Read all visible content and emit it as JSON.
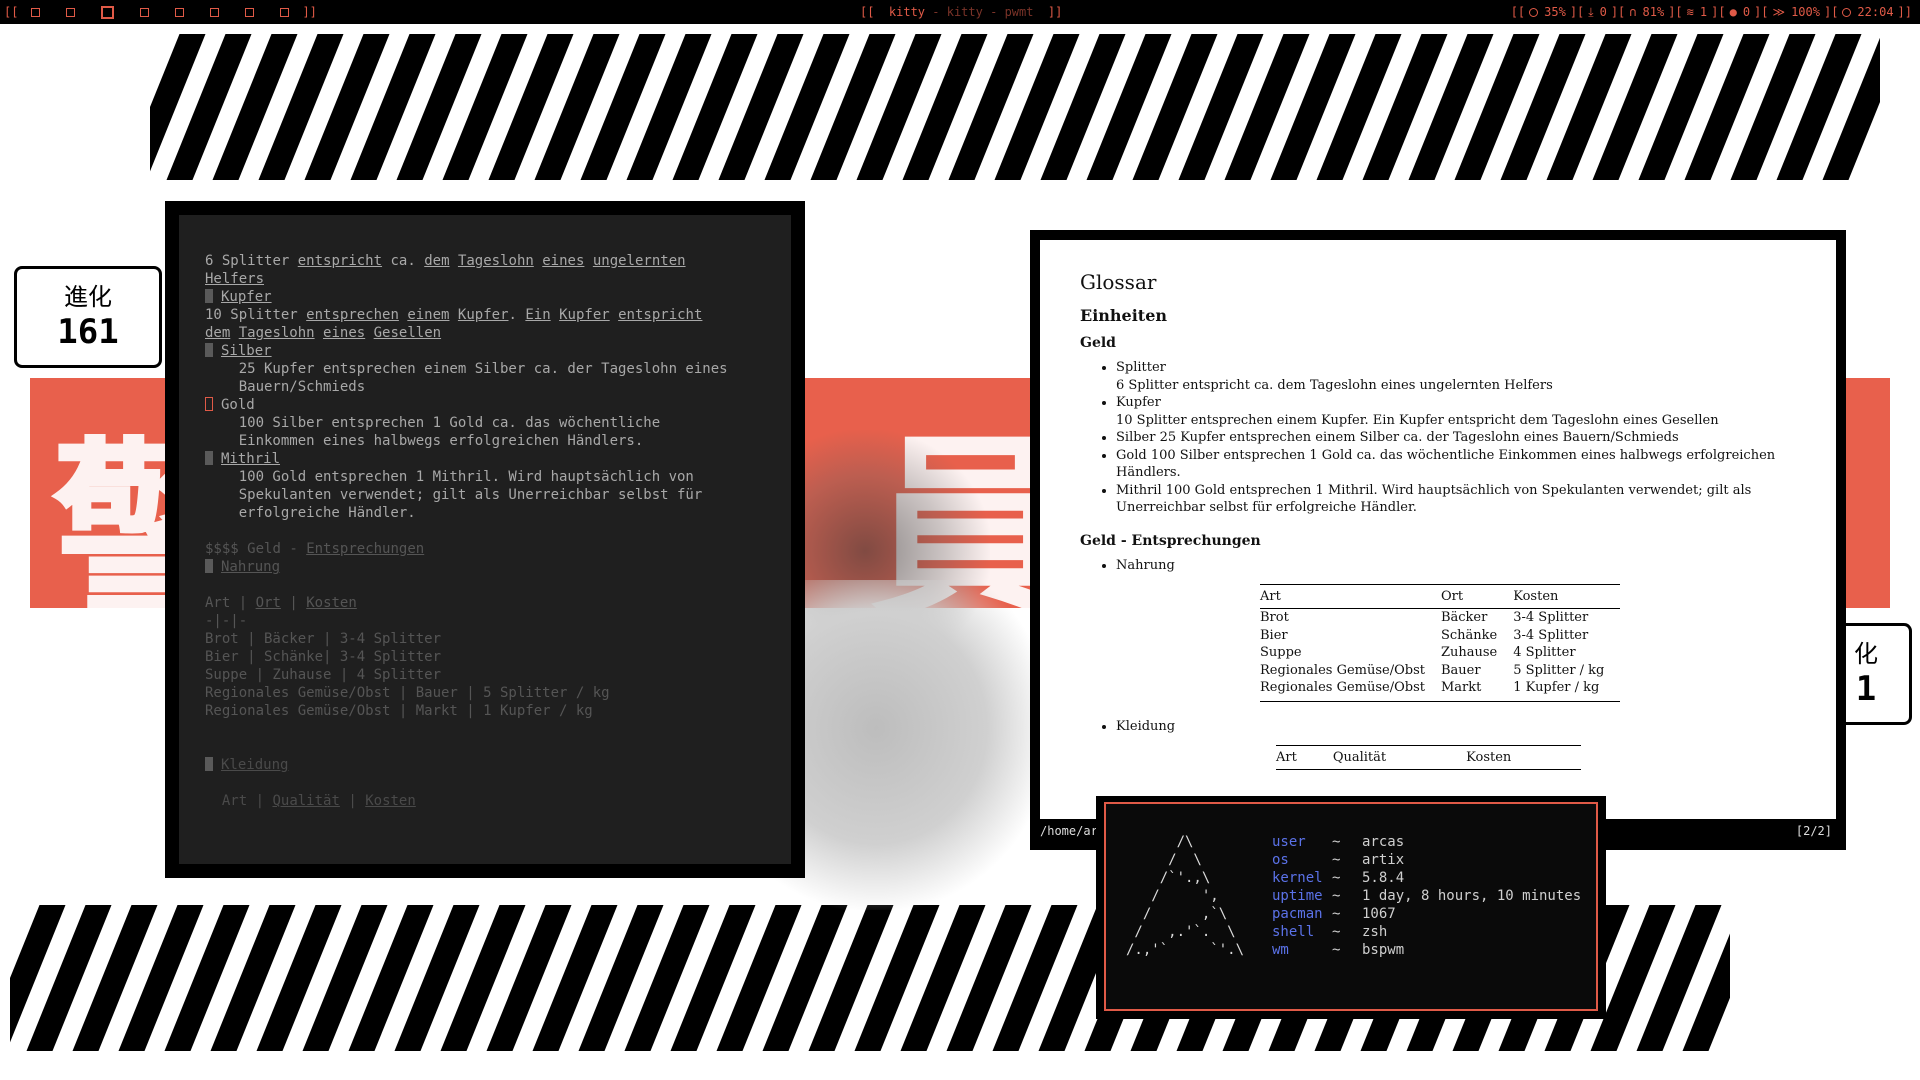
{
  "topbar": {
    "left_brackets": "[[",
    "right_brackets_left": "]]",
    "workspaces": [
      "1",
      "2",
      "3",
      "4",
      "5",
      "6",
      "7",
      "8"
    ],
    "active_workspace": "3",
    "title_open": "[[",
    "title_app": "kitty",
    "title_sep1": "-",
    "title_name": "kitty",
    "title_sep2": "-",
    "title_dir": "pwmt",
    "title_close": "]]",
    "status": {
      "open": "[[",
      "cpu": "35%",
      "downloads": "0",
      "volume": "81%",
      "wifi": "1",
      "updates": "0",
      "battery": "100%",
      "clock": "22:04",
      "close": "]]",
      "sep": "][",
      "colors": {
        "accent": "#e05a47",
        "bg": "#000000"
      }
    }
  },
  "wallpaper": {
    "badge_left": {
      "kanji": "進化",
      "number": "161"
    },
    "badge_right": {
      "kanji": "化",
      "number": "1"
    },
    "big_kanji_left": "警",
    "big_kanji_mid": "員",
    "big_kanji_right": "",
    "accent": "#e8604c"
  },
  "editor": {
    "lines": [
      {
        "t": "6 Splitter entspricht ca. dem Tageslohn eines ungelernten"
      },
      {
        "t": "Helfers"
      },
      {
        "marker": true,
        "t": "Kupfer"
      },
      {
        "t": "10 Splitter entsprechen einem Kupfer. Ein Kupfer entspricht"
      },
      {
        "t": "dem Tageslohn eines Gesellen"
      },
      {
        "marker": true,
        "t": "Silber"
      },
      {
        "t": "    25 Kupfer entsprechen einem Silber ca. der Tageslohn eines"
      },
      {
        "t": "    Bauern/Schmieds"
      },
      {
        "marker": "hl",
        "t": "Gold"
      },
      {
        "t": "    100 Silber entsprechen 1 Gold ca. das wöchentliche"
      },
      {
        "t": "    Einkommen eines halbwegs erfolgreichen Händlers."
      },
      {
        "marker": true,
        "t": "Mithril"
      },
      {
        "t": "    100 Gold entsprechen 1 Mithril. Wird hauptsächlich von"
      },
      {
        "t": "    Spekulanten verwendet; gilt als Unerreichbar selbst für"
      },
      {
        "t": "    erfolgreiche Händler."
      },
      {
        "t": ""
      },
      {
        "t": "$$$$ Geld - Entsprechungen"
      },
      {
        "marker": true,
        "t": "Nahrung"
      },
      {
        "t": ""
      },
      {
        "t": "Art | Ort | Kosten"
      },
      {
        "t": "-|-|-"
      },
      {
        "t": "Brot | Bäcker | 3-4 Splitter"
      },
      {
        "t": "Bier | Schänke| 3-4 Splitter"
      },
      {
        "t": "Suppe | Zuhause | 4 Splitter"
      },
      {
        "t": "Regionales Gemüse/Obst | Bauer | 5 Splitter / kg"
      },
      {
        "t": "Regionales Gemüse/Obst | Markt | 1 Kupfer / kg"
      },
      {
        "t": ""
      },
      {
        "t": ""
      },
      {
        "marker": true,
        "t": "Kleidung"
      },
      {
        "t": ""
      },
      {
        "t": "  Art | Qualität | Kosten"
      }
    ]
  },
  "pdf": {
    "title": "Glossar",
    "section": "Einheiten",
    "subsection1": "Geld",
    "items": [
      "Splitter",
      "6 Splitter entspricht ca. dem Tageslohn eines ungelernten Helfers",
      "Kupfer",
      "10 Splitter entsprechen einem Kupfer. Ein Kupfer entspricht dem Tageslohn eines Gesellen",
      "Silber 25 Kupfer entsprechen einem Silber ca. der Tageslohn eines Bauern/Schmieds",
      "Gold 100 Silber entsprechen 1 Gold ca. das wöchentliche Einkommen eines halbwegs erfolgreichen Händlers.",
      "Mithril 100 Gold entsprechen 1 Mithril. Wird hauptsächlich von Spekulanten verwendet; gilt als Unerreichbar selbst für erfolgreiche Händler."
    ],
    "subsection2": "Geld - Entsprechungen",
    "food_label": "Nahrung",
    "food_table": {
      "headers": [
        "Art",
        "Ort",
        "Kosten"
      ],
      "rows": [
        [
          "Brot",
          "Bäcker",
          "3-4 Splitter"
        ],
        [
          "Bier",
          "Schänke",
          "3-4 Splitter"
        ],
        [
          "Suppe",
          "Zuhause",
          "4 Splitter"
        ],
        [
          "Regionales Gemüse/Obst",
          "Bauer",
          "5 Splitter / kg"
        ],
        [
          "Regionales Gemüse/Obst",
          "Markt",
          "1 Kupfer / kg"
        ]
      ]
    },
    "clothing_label": "Kleidung",
    "clothing_headers": [
      "Art",
      "Qualität",
      "Kosten"
    ],
    "path": "/home/ar",
    "page_indicator": "[2/2]"
  },
  "fetch": {
    "art": "      /\\\n     /  \\\n    /`'.,\\\n   /     ',\n  /      ,`\\\n /   ,.'`.  \\\n/.,'`     `'.\\",
    "rows": [
      {
        "key": "user",
        "val": "arcas"
      },
      {
        "key": "os",
        "val": "artix"
      },
      {
        "key": "kernel",
        "val": "5.8.4"
      },
      {
        "key": "uptime",
        "val": "1 day, 8 hours, 10 minutes"
      },
      {
        "key": "pacman",
        "val": "1067"
      },
      {
        "key": "shell",
        "val": "zsh"
      },
      {
        "key": "wm",
        "val": "bspwm"
      }
    ],
    "tilde": "~",
    "key_color": "#5b72e8",
    "border_color": "#e05a47"
  }
}
